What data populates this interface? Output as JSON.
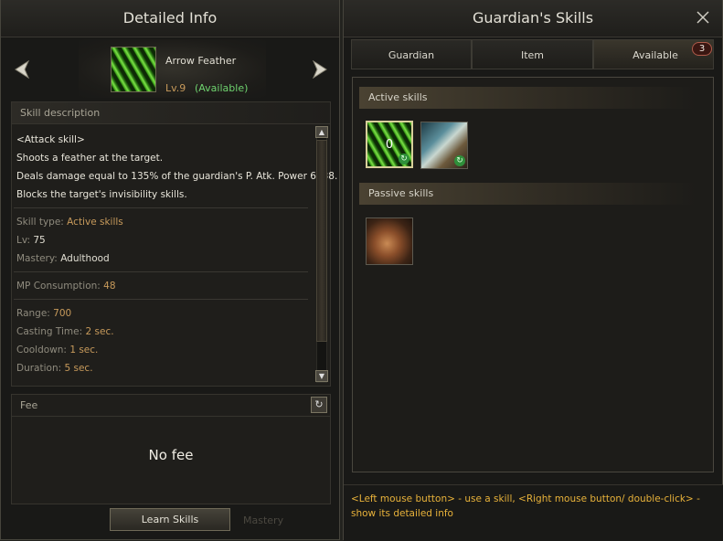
{
  "left_panel": {
    "title": "Detailed Info",
    "skill": {
      "name": "Arrow Feather",
      "level": "Lv.9",
      "status": "(Available)"
    },
    "description": {
      "header": "Skill description",
      "lines": [
        "<Attack skill>",
        "Shoots a feather at the target.",
        "Deals damage equal to 135% of the guardian's P. Atk. Power 6038.",
        "Blocks the target's invisibility skills."
      ],
      "stats": {
        "skill_type_label": "Skill type: ",
        "skill_type_value": "Active skills",
        "lv_label": "Lv: ",
        "lv_value": "75",
        "mastery_label": "Mastery: ",
        "mastery_value": "Adulthood",
        "mp_label": "MP Consumption: ",
        "mp_value": "48",
        "range_label": "Range: ",
        "range_value": "700",
        "casting_label": "Casting Time: ",
        "casting_value": "2 sec.",
        "cooldown_label": "Cooldown: ",
        "cooldown_value": "1 sec.",
        "duration_label": "Duration: ",
        "duration_value": "5 sec."
      }
    },
    "fee": {
      "header": "Fee",
      "value": "No fee"
    },
    "learn_button": "Learn Skills",
    "background_text": "Mastery"
  },
  "right_panel": {
    "title": "Guardian's Skills",
    "tabs": [
      {
        "label": "Guardian"
      },
      {
        "label": "Item"
      },
      {
        "label": "Available",
        "badge": "3"
      }
    ],
    "active_header": "Active skills",
    "passive_header": "Passive skills",
    "active_slot_count": "0",
    "footer": "<Left mouse button> - use a skill, <Right mouse button/ double-click> - show its detailed info"
  },
  "colors": {
    "accent_gold": "#e8b23a",
    "available_green": "#6fd36f",
    "stat_value": "#c79a5b"
  },
  "icons": [
    "arrow-left-icon",
    "arrow-right-icon",
    "close-icon",
    "scroll-up-icon",
    "scroll-down-icon",
    "refresh-icon"
  ]
}
